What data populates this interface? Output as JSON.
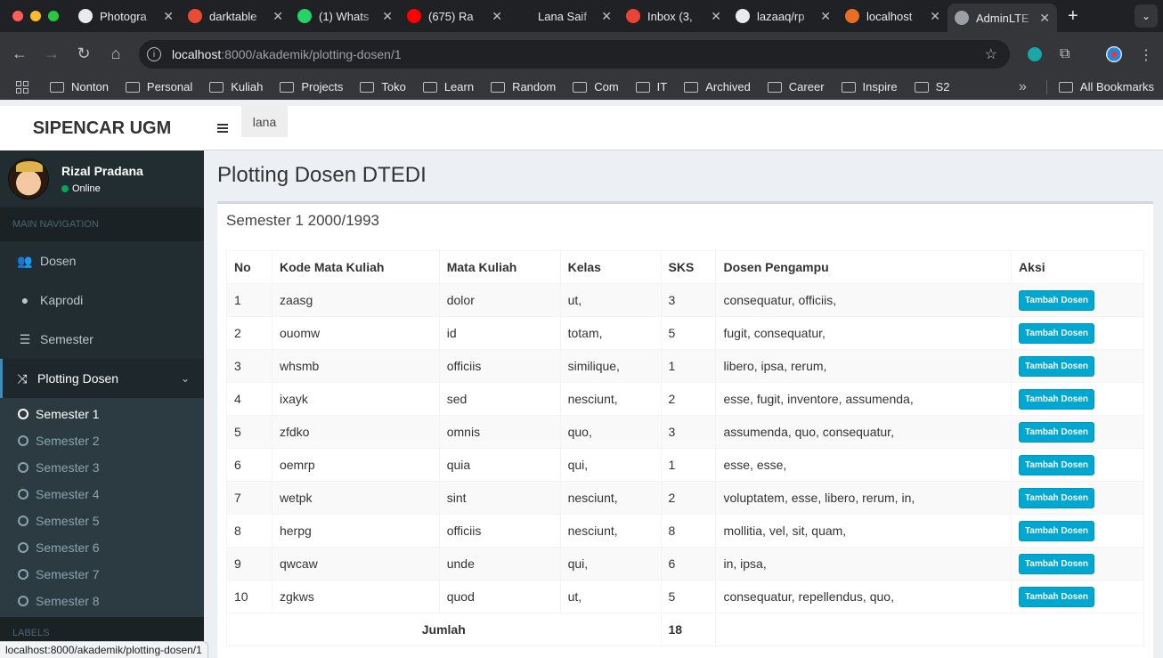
{
  "browser": {
    "traffic_colors": [
      "#ff5f57",
      "#febc2e",
      "#28c840"
    ],
    "tabs": [
      {
        "title": "Photogra",
        "fav_color": "#e8eaed"
      },
      {
        "title": "darktable",
        "fav_color": "#e94b35"
      },
      {
        "title": "(1) Whats",
        "fav_color": "#25d366"
      },
      {
        "title": "(675) Ra",
        "fav_color": "#ff0000"
      },
      {
        "title": "Lana Saif",
        "fav_color": "#202124"
      },
      {
        "title": "Inbox (3,",
        "fav_color": "#ea4335"
      },
      {
        "title": "lazaaq/rp",
        "fav_color": "#e8eaed"
      },
      {
        "title": "localhost",
        "fav_color": "#e76f24"
      },
      {
        "title": "AdminLTE",
        "fav_color": "#9aa0a6",
        "active": true
      }
    ],
    "new_tab": "+",
    "tab_close": "✕",
    "url_host": "localhost",
    "url_path": ":8000/akademik/plotting-dosen/1",
    "bookmarks": [
      "Nonton",
      "Personal",
      "Kuliah",
      "Projects",
      "Toko",
      "Learn",
      "Random",
      "Com",
      "IT",
      "Archived",
      "Career",
      "Inspire",
      "S2"
    ],
    "all_bookmarks": "All Bookmarks",
    "status_url": "localhost:8000/akademik/plotting-dosen/1"
  },
  "app": {
    "logo": "SIPENCAR UGM",
    "user_tab": "lana",
    "user": {
      "name": "Rizal Pradana",
      "status": "Online"
    },
    "nav_header": "MAIN NAVIGATION",
    "menu": [
      {
        "label": "Dosen",
        "icon": "users-icon"
      },
      {
        "label": "Kaprodi",
        "icon": "user-icon"
      },
      {
        "label": "Semester",
        "icon": "list-icon"
      },
      {
        "label": "Plotting Dosen",
        "icon": "random-icon",
        "active": true
      }
    ],
    "submenu": [
      "Semester 1",
      "Semester 2",
      "Semester 3",
      "Semester 4",
      "Semester 5",
      "Semester 6",
      "Semester 7",
      "Semester 8"
    ],
    "labels_header": "LABELS",
    "page_title": "Plotting Dosen DTEDI",
    "box_title": "Semester 1 2000/1993",
    "table": {
      "headers": [
        "No",
        "Kode Mata Kuliah",
        "Mata Kuliah",
        "Kelas",
        "SKS",
        "Dosen Pengampu",
        "Aksi"
      ],
      "rows": [
        [
          "1",
          "zaasg",
          "dolor",
          "ut,",
          "3",
          "consequatur, officiis,"
        ],
        [
          "2",
          "ouomw",
          "id",
          "totam,",
          "5",
          "fugit, consequatur,"
        ],
        [
          "3",
          "whsmb",
          "officiis",
          "similique,",
          "1",
          "libero, ipsa, rerum,"
        ],
        [
          "4",
          "ixayk",
          "sed",
          "nesciunt,",
          "2",
          "esse, fugit, inventore, assumenda,"
        ],
        [
          "5",
          "zfdko",
          "omnis",
          "quo,",
          "3",
          "assumenda, quo, consequatur,"
        ],
        [
          "6",
          "oemrp",
          "quia",
          "qui,",
          "1",
          "esse, esse,"
        ],
        [
          "7",
          "wetpk",
          "sint",
          "nesciunt,",
          "2",
          "voluptatem, esse, libero, rerum, in,"
        ],
        [
          "8",
          "herpg",
          "officiis",
          "nesciunt,",
          "8",
          "mollitia, vel, sit, quam,"
        ],
        [
          "9",
          "qwcaw",
          "unde",
          "qui,",
          "6",
          "in, ipsa,"
        ],
        [
          "10",
          "zgkws",
          "quod",
          "ut,",
          "5",
          "consequatur, repellendus, quo,"
        ]
      ],
      "action_label": "Tambah Dosen",
      "total_label": "Jumlah",
      "total_value": "18"
    }
  }
}
